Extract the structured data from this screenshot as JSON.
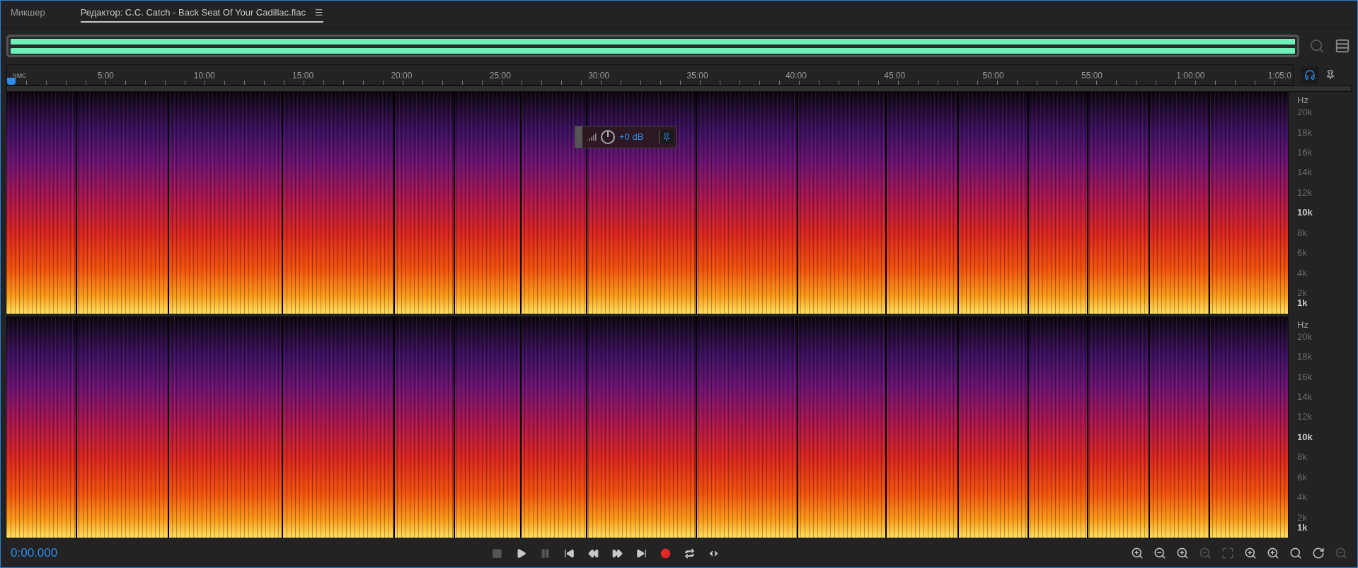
{
  "tabs": [
    {
      "label": "Микшер",
      "selected": false
    },
    {
      "label": "Редактор: C.C. Catch - Back Seat Of Your Cadillac.flac",
      "selected": true
    }
  ],
  "ruler": {
    "unit": "чмс",
    "labels": [
      "5:00",
      "10:00",
      "15:00",
      "20:00",
      "25:00",
      "30:00",
      "35:00",
      "40:00",
      "45:00",
      "50:00",
      "55:00",
      "1:00:00",
      "1:05:0"
    ]
  },
  "hud": {
    "gain": "+0 dB"
  },
  "channels": [
    {
      "unit": "Hz",
      "ticks": [
        {
          "label": "20k",
          "major": false
        },
        {
          "label": "18k",
          "major": false
        },
        {
          "label": "16k",
          "major": false
        },
        {
          "label": "14k",
          "major": false
        },
        {
          "label": "12k",
          "major": false
        },
        {
          "label": "10k",
          "major": true
        },
        {
          "label": "8k",
          "major": false
        },
        {
          "label": "6k",
          "major": false
        },
        {
          "label": "4k",
          "major": false
        },
        {
          "label": "2k",
          "major": false
        },
        {
          "label": "1k",
          "major": true
        }
      ]
    },
    {
      "unit": "Hz",
      "ticks": [
        {
          "label": "20k",
          "major": false
        },
        {
          "label": "18k",
          "major": false
        },
        {
          "label": "16k",
          "major": false
        },
        {
          "label": "14k",
          "major": false
        },
        {
          "label": "12k",
          "major": false
        },
        {
          "label": "10k",
          "major": true
        },
        {
          "label": "8k",
          "major": false
        },
        {
          "label": "6k",
          "major": false
        },
        {
          "label": "4k",
          "major": false
        },
        {
          "label": "2k",
          "major": false
        },
        {
          "label": "1k",
          "major": true
        }
      ]
    }
  ],
  "status": {
    "time": "0:00.000"
  },
  "transport": [
    {
      "kind": "stop",
      "disabled": true
    },
    {
      "kind": "play",
      "disabled": false
    },
    {
      "kind": "pause",
      "disabled": true
    },
    {
      "kind": "start",
      "disabled": false
    },
    {
      "kind": "rewind",
      "disabled": false
    },
    {
      "kind": "forward",
      "disabled": false
    },
    {
      "kind": "end",
      "disabled": false
    },
    {
      "kind": "record",
      "disabled": false
    },
    {
      "kind": "loop",
      "disabled": false
    },
    {
      "kind": "skip",
      "disabled": false
    }
  ],
  "zoom_tools": [
    {
      "kind": "zoom-in-amp",
      "disabled": false
    },
    {
      "kind": "zoom-out-amp",
      "disabled": false
    },
    {
      "kind": "zoom-in-time",
      "disabled": false
    },
    {
      "kind": "zoom-out-time",
      "disabled": true
    },
    {
      "kind": "zoom-full",
      "disabled": true
    },
    {
      "kind": "zoom-in-left",
      "disabled": false
    },
    {
      "kind": "zoom-in-right",
      "disabled": false
    },
    {
      "kind": "zoom-selection",
      "disabled": false
    },
    {
      "kind": "zoom-reset",
      "disabled": false
    },
    {
      "kind": "zoom-out-full",
      "disabled": true
    }
  ]
}
